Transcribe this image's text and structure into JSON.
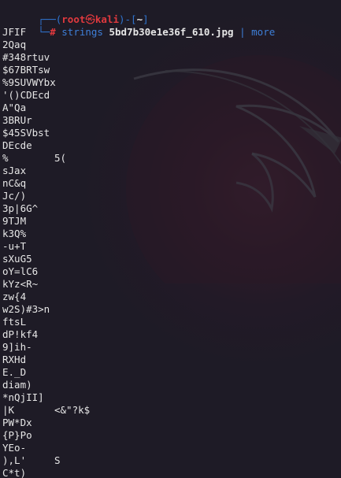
{
  "prompt": {
    "corner_top": "┌──(",
    "user": "root",
    "skull": "㉿",
    "host": "kali",
    "sep": ")-[",
    "dir": "~",
    "close": "]",
    "corner_bottom": "└─",
    "hash": "#"
  },
  "command": {
    "name": "strings",
    "arg": "5bd7b30e1e36f_610.jpg",
    "pipe": "|",
    "pager": "more"
  },
  "output": [
    {
      "c1": "JFIF",
      "c2": ""
    },
    {
      "c1": "2Qaq",
      "c2": ""
    },
    {
      "c1": "#348rtuv",
      "c2": ""
    },
    {
      "c1": "$67BRTsw",
      "c2": ""
    },
    {
      "c1": "%9SUVWYbx",
      "c2": ""
    },
    {
      "c1": "'()CDEcd",
      "c2": ""
    },
    {
      "c1": "A\"Qa",
      "c2": ""
    },
    {
      "c1": "3BRUr",
      "c2": ""
    },
    {
      "c1": "$45SVbst",
      "c2": ""
    },
    {
      "c1": "DEcde",
      "c2": ""
    },
    {
      "c1": "%",
      "c2": "5("
    },
    {
      "c1": "sJax",
      "c2": ""
    },
    {
      "c1": "nC&q",
      "c2": ""
    },
    {
      "c1": "Jc/)",
      "c2": ""
    },
    {
      "c1": "3p|6G^",
      "c2": ""
    },
    {
      "c1": "9TJM",
      "c2": ""
    },
    {
      "c1": "k3Q%",
      "c2": ""
    },
    {
      "c1": "-u+T",
      "c2": ""
    },
    {
      "c1": "sXuG5",
      "c2": ""
    },
    {
      "c1": "oY=lC6",
      "c2": ""
    },
    {
      "c1": "kYz<R~",
      "c2": ""
    },
    {
      "c1": "zw{4",
      "c2": ""
    },
    {
      "c1": "w2S)#3>n",
      "c2": ""
    },
    {
      "c1": "ftsL",
      "c2": ""
    },
    {
      "c1": "dP!kf4",
      "c2": ""
    },
    {
      "c1": "9]ih-",
      "c2": ""
    },
    {
      "c1": "RXHd",
      "c2": ""
    },
    {
      "c1": "E._D",
      "c2": ""
    },
    {
      "c1": "diam)",
      "c2": ""
    },
    {
      "c1": "*nQjII]",
      "c2": ""
    },
    {
      "c1": "|K",
      "c2": "<&\"?k$"
    },
    {
      "c1": "PW*Dx",
      "c2": ""
    },
    {
      "c1": "{P}Po",
      "c2": ""
    },
    {
      "c1": "YEo-",
      "c2": ""
    },
    {
      "c1": "),L'",
      "c2": "S"
    },
    {
      "c1": "C*t)",
      "c2": ""
    }
  ],
  "colors": {
    "background": "#1e1b26",
    "prompt_blue": "#2f74d0",
    "prompt_red": "#e0393e",
    "text": "#e6e6e6"
  }
}
